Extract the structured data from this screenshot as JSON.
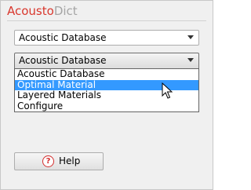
{
  "app": {
    "title_part1": "Acousto",
    "title_part2": "Dict",
    "colors": {
      "title_accent": "#d9372d",
      "title_muted": "#a5a5a5",
      "selection": "#3399ff",
      "help_icon": "#d32d2d"
    }
  },
  "combo1": {
    "value": "Acoustic Database",
    "icon": "chevron-down-icon"
  },
  "combo2": {
    "value": "Acoustic Database",
    "icon": "chevron-down-icon",
    "options": [
      "Acoustic Database",
      "Optimal Material",
      "Layered Materials",
      "Configure"
    ],
    "highlighted": "Optimal Material"
  },
  "help_button": {
    "label": "Help",
    "icon_glyph": "?",
    "icon": "help-icon"
  }
}
